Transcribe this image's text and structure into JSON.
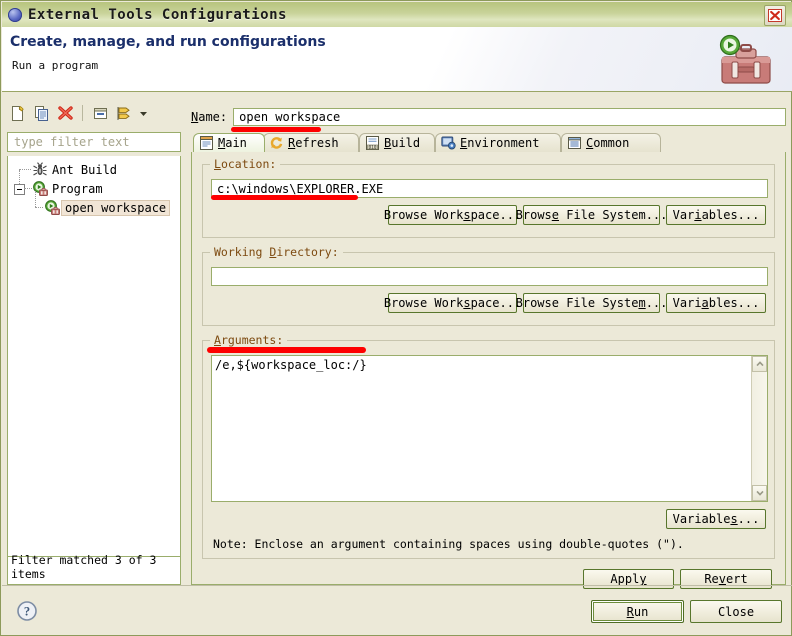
{
  "window": {
    "title": "External Tools Configurations",
    "icon": "eclipse-globe-icon",
    "close_label": "✕"
  },
  "banner": {
    "title": "Create, manage, and run configurations",
    "subtitle": "Run a program",
    "icon": "toolbox-run-icon"
  },
  "left_panel": {
    "toolbar": [
      {
        "name": "new-launch-configuration-icon",
        "tooltip": "New launch configuration"
      },
      {
        "name": "duplicate-launch-configuration-icon",
        "tooltip": "Duplicate"
      },
      {
        "name": "delete-launch-configuration-icon",
        "tooltip": "Delete"
      },
      {
        "name": "collapse-all-icon",
        "tooltip": "Collapse All"
      },
      {
        "name": "filter-launch-configurations-icon",
        "tooltip": "Filter"
      },
      {
        "name": "chevron-down-icon",
        "tooltip": "Menu"
      }
    ],
    "filter": {
      "placeholder": "type filter text",
      "value": ""
    },
    "tree": [
      {
        "label": "Ant Build",
        "icon": "ant-build-icon",
        "level": 1,
        "expanded": null,
        "selected": false
      },
      {
        "label": "Program",
        "icon": "program-icon",
        "level": 1,
        "expanded": true,
        "selected": false
      },
      {
        "label": "open workspace",
        "icon": "program-icon",
        "level": 2,
        "expanded": null,
        "selected": true
      }
    ],
    "status": "Filter matched 3 of 3 items"
  },
  "main": {
    "name_label": "Name:",
    "name_mnemonic": "N",
    "name_value": "open workspace",
    "tabs": [
      {
        "label": "Main",
        "mnemonic": "M",
        "icon": "main-tab-icon",
        "active": true
      },
      {
        "label": "Refresh",
        "mnemonic": "R",
        "icon": "refresh-tab-icon",
        "active": false
      },
      {
        "label": "Build",
        "mnemonic": "B",
        "icon": "build-tab-icon",
        "active": false
      },
      {
        "label": "Environment",
        "mnemonic": "E",
        "icon": "environment-tab-icon",
        "active": false
      },
      {
        "label": "Common",
        "mnemonic": "C",
        "icon": "common-tab-icon",
        "active": false
      }
    ],
    "location": {
      "group_label": "Location:",
      "value": "c:\\windows\\EXPLORER.EXE",
      "buttons": [
        "Browse Workspace...",
        "Browse File System...",
        "Variables..."
      ]
    },
    "working_directory": {
      "group_label": "Working Directory:",
      "value": "",
      "buttons": [
        "Browse Workspace...",
        "Browse File System...",
        "Variables..."
      ]
    },
    "arguments": {
      "group_label": "Arguments:",
      "value": "/e,${workspace_loc:/}",
      "variables_button": "Variables...",
      "note": "Note: Enclose an argument containing spaces using double-quotes (\")."
    },
    "apply_label": "Apply",
    "revert_label": "Revert"
  },
  "footer": {
    "help_icon": "help-question-icon",
    "run_label": "Run",
    "close_label": "Close"
  },
  "colors": {
    "dialog_bg": "#ece9d8",
    "title_gradient_start": "#b7c47e",
    "title_gradient_end": "#cfd8a4",
    "banner_title": "#1b2f6b",
    "group_label": "#7d4a10",
    "field_border": "#9aad6b",
    "button_border": "#58762c",
    "annotation_red": "#fe0000",
    "selection_bg": "#f1e5d6"
  },
  "annotations": [
    {
      "name": "name-field-underline"
    },
    {
      "name": "location-field-underline"
    },
    {
      "name": "arguments-field-underline"
    }
  ]
}
